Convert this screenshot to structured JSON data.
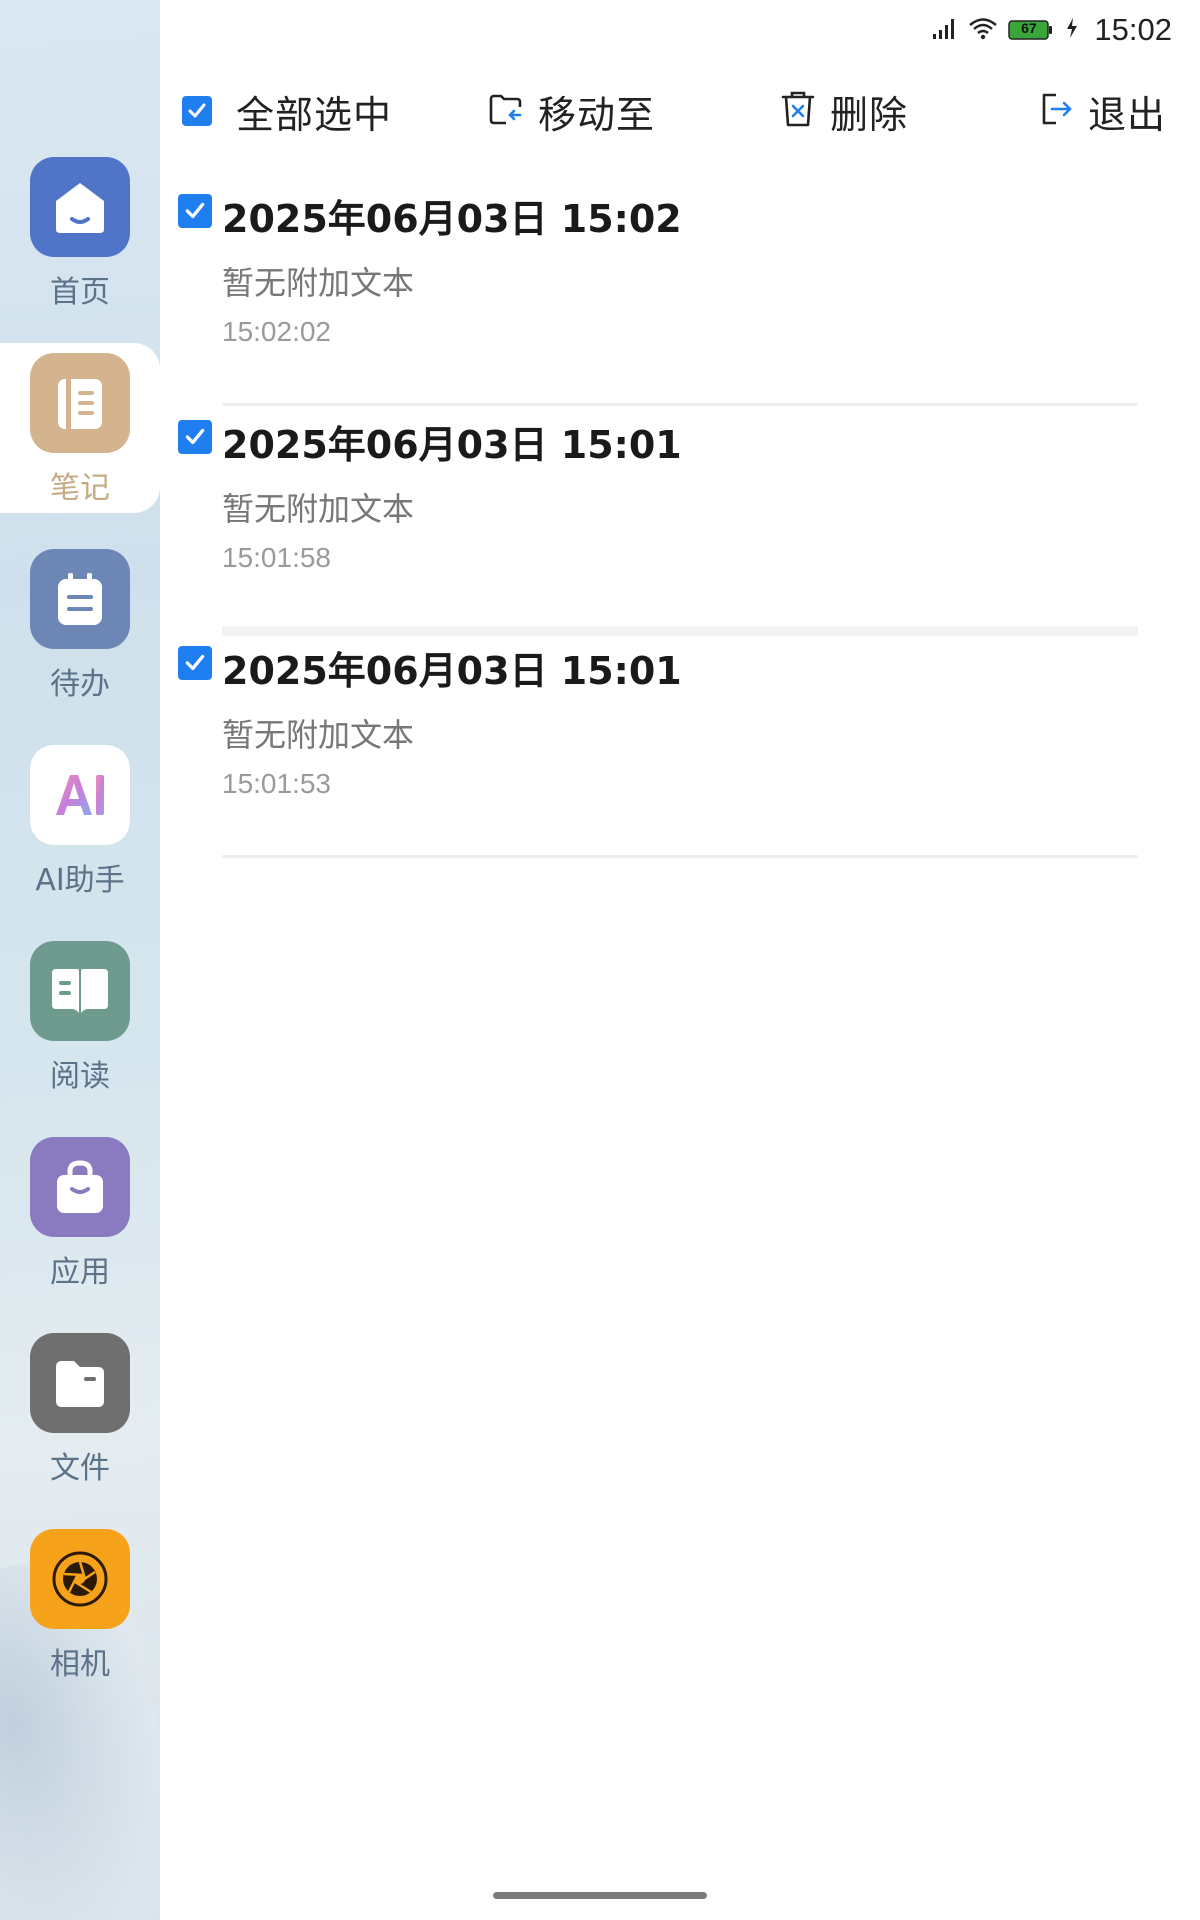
{
  "status_bar": {
    "battery": "67",
    "time": "15:02"
  },
  "toolbar": {
    "select_all": "全部选中",
    "move_to": "移动至",
    "delete": "删除",
    "exit": "退出"
  },
  "notes": [
    {
      "title": "2025年06月03日 15:02",
      "subtitle": "暂无附加文本",
      "time": "15:02:02",
      "checked": true
    },
    {
      "title": "2025年06月03日 15:01",
      "subtitle": "暂无附加文本",
      "time": "15:01:58",
      "checked": true
    },
    {
      "title": "2025年06月03日 15:01",
      "subtitle": "暂无附加文本",
      "time": "15:01:53",
      "checked": true
    }
  ],
  "sidebar": {
    "active": "笔记",
    "items": [
      {
        "label": "首页",
        "icon": "home-icon",
        "color": "#4f74c8"
      },
      {
        "label": "笔记",
        "icon": "notebook-icon",
        "color": "#d4b48f"
      },
      {
        "label": "待办",
        "icon": "todo-icon",
        "color": "#6c86b5"
      },
      {
        "label": "AI助手",
        "icon": "ai-assistant-icon",
        "color": "#ffffff"
      },
      {
        "label": "阅读",
        "icon": "book-icon",
        "color": "#6f9a8e"
      },
      {
        "label": "应用",
        "icon": "shopping-bag-icon",
        "color": "#8a7bc0"
      },
      {
        "label": "文件",
        "icon": "folder-icon",
        "color": "#6f6f6f"
      },
      {
        "label": "相机",
        "icon": "camera-aperture-icon",
        "color": "#f7a21b"
      }
    ]
  },
  "colors": {
    "accent": "#1f7ff0",
    "active_label": "#c5ab84",
    "sidebar_label": "#5b7288"
  }
}
